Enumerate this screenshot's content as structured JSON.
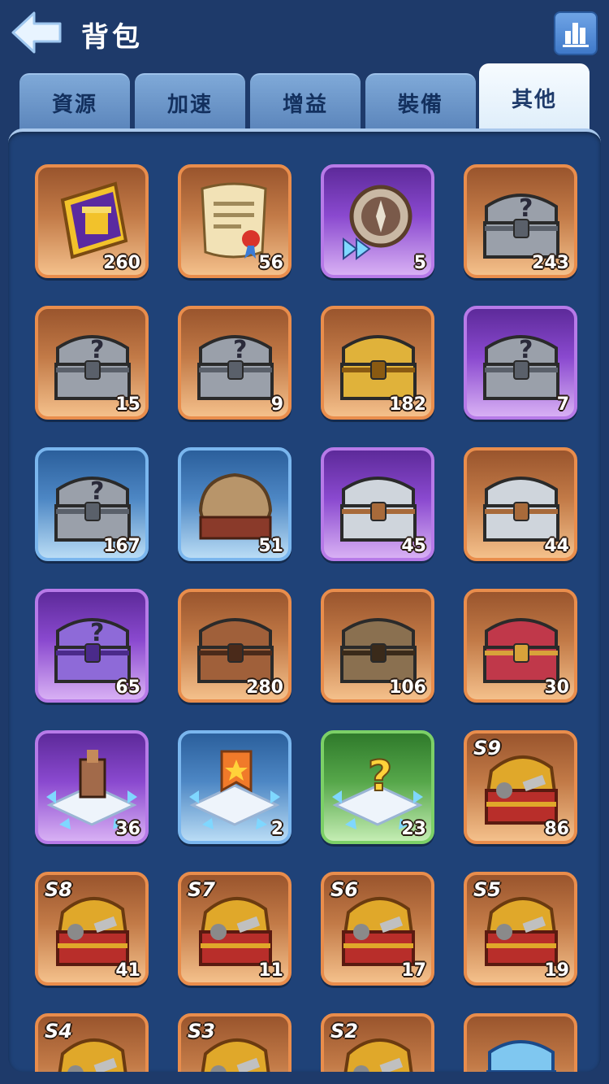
{
  "header": {
    "title": "背包",
    "back_icon": "arrow-left-icon",
    "stats_icon": "bar-chart-icon"
  },
  "tabs": [
    {
      "label": "資源",
      "active": false
    },
    {
      "label": "加速",
      "active": false
    },
    {
      "label": "增益",
      "active": false
    },
    {
      "label": "裝備",
      "active": false
    },
    {
      "label": "其他",
      "active": true
    }
  ],
  "items": [
    {
      "icon": "gold-ticket-icon",
      "rarity": "orange",
      "count": "260"
    },
    {
      "icon": "scroll-icon",
      "rarity": "orange",
      "count": "56"
    },
    {
      "icon": "compass-icon",
      "rarity": "purple",
      "count": "5"
    },
    {
      "icon": "mystery-chest-weapons-icon",
      "rarity": "orange",
      "count": "243"
    },
    {
      "icon": "mystery-chest-resources-icon",
      "rarity": "orange",
      "count": "15"
    },
    {
      "icon": "mystery-chest-cards-icon",
      "rarity": "orange",
      "count": "9"
    },
    {
      "icon": "gold-chest-resources-icon",
      "rarity": "orange",
      "count": "182"
    },
    {
      "icon": "mystery-chest-rune-icon",
      "rarity": "purple",
      "count": "7"
    },
    {
      "icon": "mystery-chest-icon",
      "rarity": "blue",
      "count": "167"
    },
    {
      "icon": "loot-sack-icon",
      "rarity": "blue",
      "count": "51"
    },
    {
      "icon": "silver-crate-icon",
      "rarity": "purple",
      "count": "45"
    },
    {
      "icon": "silver-crate-icon",
      "rarity": "orange",
      "count": "44"
    },
    {
      "icon": "purple-mystery-chest-icon",
      "rarity": "purple",
      "count": "65"
    },
    {
      "icon": "bronze-chest-icon",
      "rarity": "orange",
      "count": "280"
    },
    {
      "icon": "helmet-chest-icon",
      "rarity": "orange",
      "count": "106"
    },
    {
      "icon": "red-gold-chest-icon",
      "rarity": "orange",
      "count": "30"
    },
    {
      "icon": "building-relocation-icon",
      "rarity": "purple",
      "count": "36"
    },
    {
      "icon": "banner-relocation-icon",
      "rarity": "blue",
      "count": "2"
    },
    {
      "icon": "random-relocation-icon",
      "rarity": "green",
      "count": "23"
    },
    {
      "icon": "season-chest-icon",
      "rarity": "orange",
      "count": "86",
      "season": "S9"
    },
    {
      "icon": "season-chest-icon",
      "rarity": "orange",
      "count": "41",
      "season": "S8"
    },
    {
      "icon": "season-chest-icon",
      "rarity": "orange",
      "count": "11",
      "season": "S7"
    },
    {
      "icon": "season-chest-icon",
      "rarity": "orange",
      "count": "17",
      "season": "S6"
    },
    {
      "icon": "season-chest-icon",
      "rarity": "orange",
      "count": "19",
      "season": "S5"
    },
    {
      "icon": "season-chest-icon",
      "rarity": "orange",
      "count": "",
      "season": "S4"
    },
    {
      "icon": "season-chest-icon",
      "rarity": "orange",
      "count": "",
      "season": "S3"
    },
    {
      "icon": "season-chest-icon",
      "rarity": "orange",
      "count": "",
      "season": "S2"
    },
    {
      "icon": "ice-chest-icon",
      "rarity": "orange",
      "count": ""
    }
  ]
}
